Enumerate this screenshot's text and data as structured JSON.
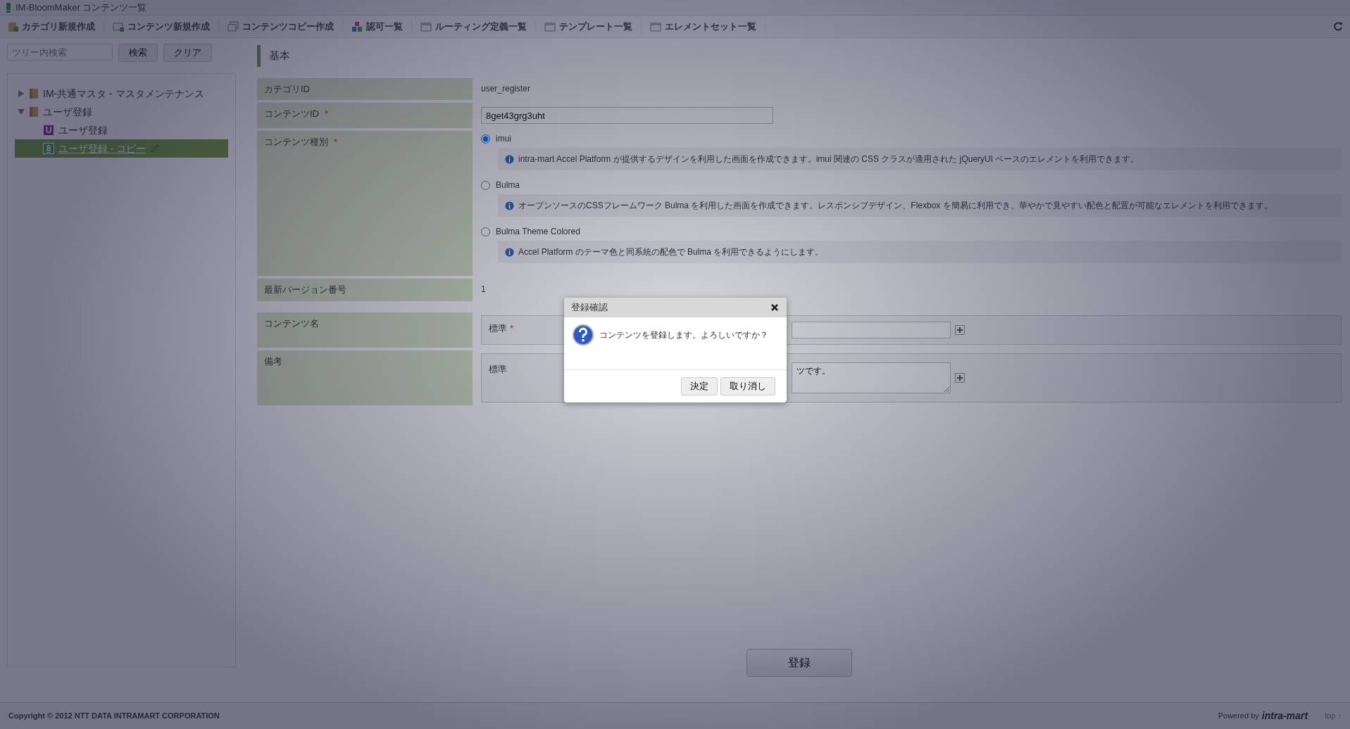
{
  "window": {
    "title": "IM-BloomMaker コンテンツ一覧"
  },
  "toolbar": {
    "items": [
      {
        "label": "カテゴリ新規作成",
        "kind": "category"
      },
      {
        "label": "コンテンツ新規作成",
        "kind": "content"
      },
      {
        "label": "コンテンツコピー作成",
        "kind": "copy"
      },
      {
        "label": "認可一覧",
        "kind": "auth"
      },
      {
        "label": "ルーティング定義一覧",
        "kind": "list"
      },
      {
        "label": "テンプレート一覧",
        "kind": "list"
      },
      {
        "label": "エレメントセット一覧",
        "kind": "list"
      }
    ]
  },
  "sidebar": {
    "search": {
      "placeholder": "ツリー内検索"
    },
    "buttons": [
      "検索",
      "クリア"
    ],
    "tree": [
      {
        "label": "IM-共通マスタ - マスタメンテナンス",
        "kind": "folder",
        "expanded": false,
        "selected": false
      },
      {
        "label": "ユーザ登録",
        "kind": "folder",
        "expanded": true,
        "selected": false,
        "children": [
          {
            "label": "ユーザ登録",
            "badge": "U",
            "selected": false
          },
          {
            "label": "ユーザ登録 - コピー",
            "badge": "8",
            "selected": true
          }
        ]
      }
    ]
  },
  "form": {
    "section": "基本",
    "rows": [
      {
        "kind": "text",
        "label": "カテゴリID",
        "value": "user_register"
      },
      {
        "kind": "input",
        "label": "コンテンツID",
        "required_mark": "*",
        "value": "8get43grg3uht"
      },
      {
        "kind": "radios",
        "label": "コンテンツ種別",
        "required_mark": "*",
        "options": [
          {
            "label": "imui",
            "selected": true,
            "info": "intra-mart Accel Platform が提供するデザインを利用した画面を作成できます。imui 関連の CSS クラスが適用された jQueryUI ベースのエレメントを利用できます。"
          },
          {
            "label": "Bulma",
            "selected": false,
            "info": "オープンソースのCSSフレームワーク Bulma を利用した画面を作成できます。レスポンシブデザイン、Flexbox を簡易に利用でき、華やかで見やすい配色と配置が可能なエレメントを利用できます。"
          },
          {
            "label": "Bulma Theme Colored",
            "selected": false,
            "info": "Accel Platform のテーマ色と同系統の配色で Bulma を利用できるようにします。"
          }
        ]
      },
      {
        "kind": "text",
        "label": "最新バージョン番号",
        "value": "1"
      }
    ],
    "locale_rows": [
      {
        "label": "コンテンツ名",
        "locale": "標準",
        "required_mark": "*",
        "kind": "input"
      },
      {
        "label": "備考",
        "locale": "標準",
        "kind": "textarea",
        "value": "ツです。"
      }
    ],
    "submit": "登録"
  },
  "dialog": {
    "title": "登録確認",
    "message": "コンテンツを登録します。よろしいですか？",
    "buttons": [
      "決定",
      "取り消し"
    ]
  },
  "footer": {
    "copyright": "Copyright © 2012 NTT DATA INTRAMART CORPORATION",
    "powered": "Powered by",
    "logo": "intra-mart",
    "top": "top ↑"
  }
}
